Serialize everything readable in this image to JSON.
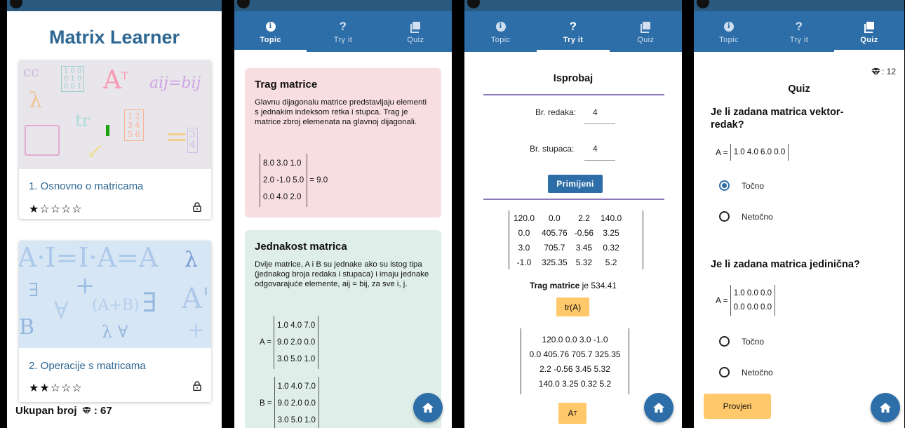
{
  "home": {
    "title": "Matrix Learner",
    "cards": [
      {
        "title": "1. Osnovno o matricama",
        "stars": "★☆☆☆☆"
      },
      {
        "title": "2. Operacije s matricama",
        "stars": "★★☆☆☆"
      }
    ],
    "total_label": "Ukupan broj",
    "total_value": ": 67"
  },
  "tabs": [
    "Topic",
    "Try it",
    "Quiz"
  ],
  "topic": {
    "box1": {
      "title": "Trag matrice",
      "text": "Glavnu dijagonalu matrice predstavljaju elementi s jednakim indeksom retka i stupca. Trag  je matrice zbroj elemenata na glavnoj dijagonali.",
      "rows": [
        "8.0  3.0  1.0",
        "2.0  -1.0  5.0",
        "0.0  4.0  2.0"
      ],
      "result": "= 9.0"
    },
    "box2": {
      "title": "Jednakost matrica",
      "text": "Dvije matrice, A i B su jednake ako su istog tipa (jednakog broja redaka i stupaca) i imaju jednake odgovarajuće elemente, aij = bij, za sve i, j.",
      "a_label": "A =",
      "a_rows": [
        "1.0  4.0  7.0",
        "9.0  2.0  0.0",
        "3.0  5.0  1.0"
      ],
      "b_label": "B =",
      "b_rows": [
        "1.0  4.0  7.0",
        "9.0  2.0  0.0",
        "3.0  5.0  1.0"
      ]
    }
  },
  "tryit": {
    "title": "Isprobaj",
    "rows_label": "Br. redaka:",
    "rows_value": "4",
    "cols_label": "Br. stupaca:",
    "cols_value": "4",
    "apply_label": "Primijeni",
    "matrix": [
      [
        "120.0",
        "0.0",
        "2.2",
        "140.0"
      ],
      [
        "0.0",
        "405.76",
        "-0.56",
        "3.25"
      ],
      [
        "3.0",
        "705.7",
        "3.45",
        "0.32"
      ],
      [
        "-1.0",
        "325.35",
        "5.32",
        "5.2"
      ]
    ],
    "trace_bold": "Trag matrice",
    "trace_rest": " je  534.41",
    "trace_btn": "tr(A)",
    "transpose_rows": [
      "120.0  0.0  3.0  -1.0",
      "0.0  405.76  705.7  325.35",
      "2.2  -0.56  3.45  5.32",
      "140.0  3.25  0.32  5.2"
    ],
    "transpose_btn": "A",
    "transpose_sup": "T"
  },
  "quiz": {
    "score": ": 12",
    "title": "Quiz",
    "q1": "Je li zadana matrica vektor-redak?",
    "q1_matrix_label": "A =",
    "q1_matrix": "1.0  4.0  6.0  0.0",
    "q2": "Je li zadana matrica jedinična?",
    "q2_matrix_label": "A =",
    "q2_rows": [
      "1.0  0.0  0.0",
      "0.0  0.0  0.0"
    ],
    "opt_true": "Točno",
    "opt_false": "Netočno",
    "check_btn": "Provjeri"
  },
  "colors": {
    "primary": "#2d6da8",
    "title_blue": "#2d6793",
    "pink": "#f8dde1",
    "mint": "#dfeee8",
    "yellow": "#ffc86b"
  }
}
